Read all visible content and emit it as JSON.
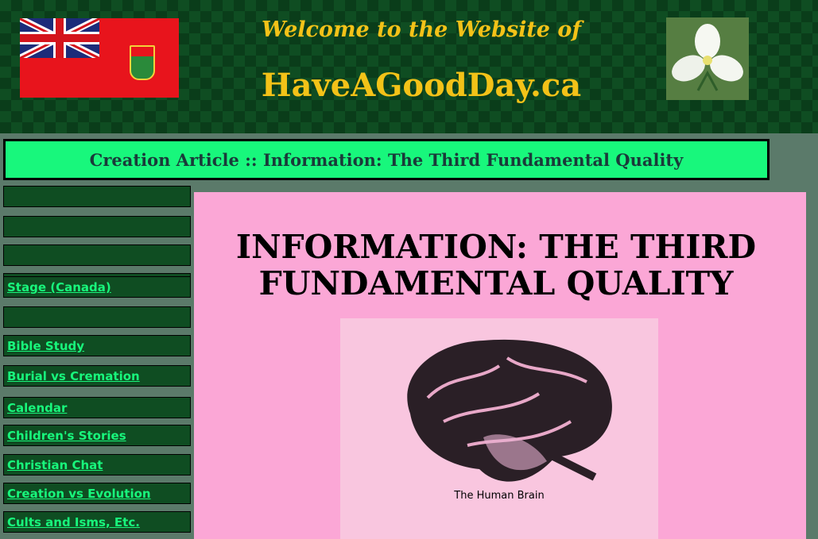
{
  "header": {
    "welcome_text": "Welcome to the Website of",
    "site_name": "HaveAGoodDay.ca",
    "flag_icon": "ontario-flag-icon",
    "logo_icon": "trillium-flower-icon"
  },
  "banner": {
    "title": "Creation Article :: Information: The Third Fundamental Quality"
  },
  "sidebar": {
    "items": [
      {
        "label": ""
      },
      {
        "label": ""
      },
      {
        "label": ""
      },
      {
        "label": ""
      },
      {
        "label": "Stage (Canada)"
      },
      {
        "label": ""
      },
      {
        "label": "Bible Study"
      },
      {
        "label": "Burial vs Cremation"
      },
      {
        "label": "Calendar"
      },
      {
        "label": "Children's Stories"
      },
      {
        "label": "Christian Chat"
      },
      {
        "label": "Creation vs Evolution"
      },
      {
        "label": "Cults and Isms, Etc."
      }
    ]
  },
  "article": {
    "heading": "INFORMATION: THE THIRD FUNDAMENTAL QUALITY",
    "image_caption": "The Human Brain",
    "image_subcaption": ""
  },
  "colors": {
    "header_green": "#0f4d22",
    "gold": "#f3c218",
    "banner_green": "#18f77c",
    "content_pink": "#fba7d6",
    "link_green": "#18f77c"
  }
}
